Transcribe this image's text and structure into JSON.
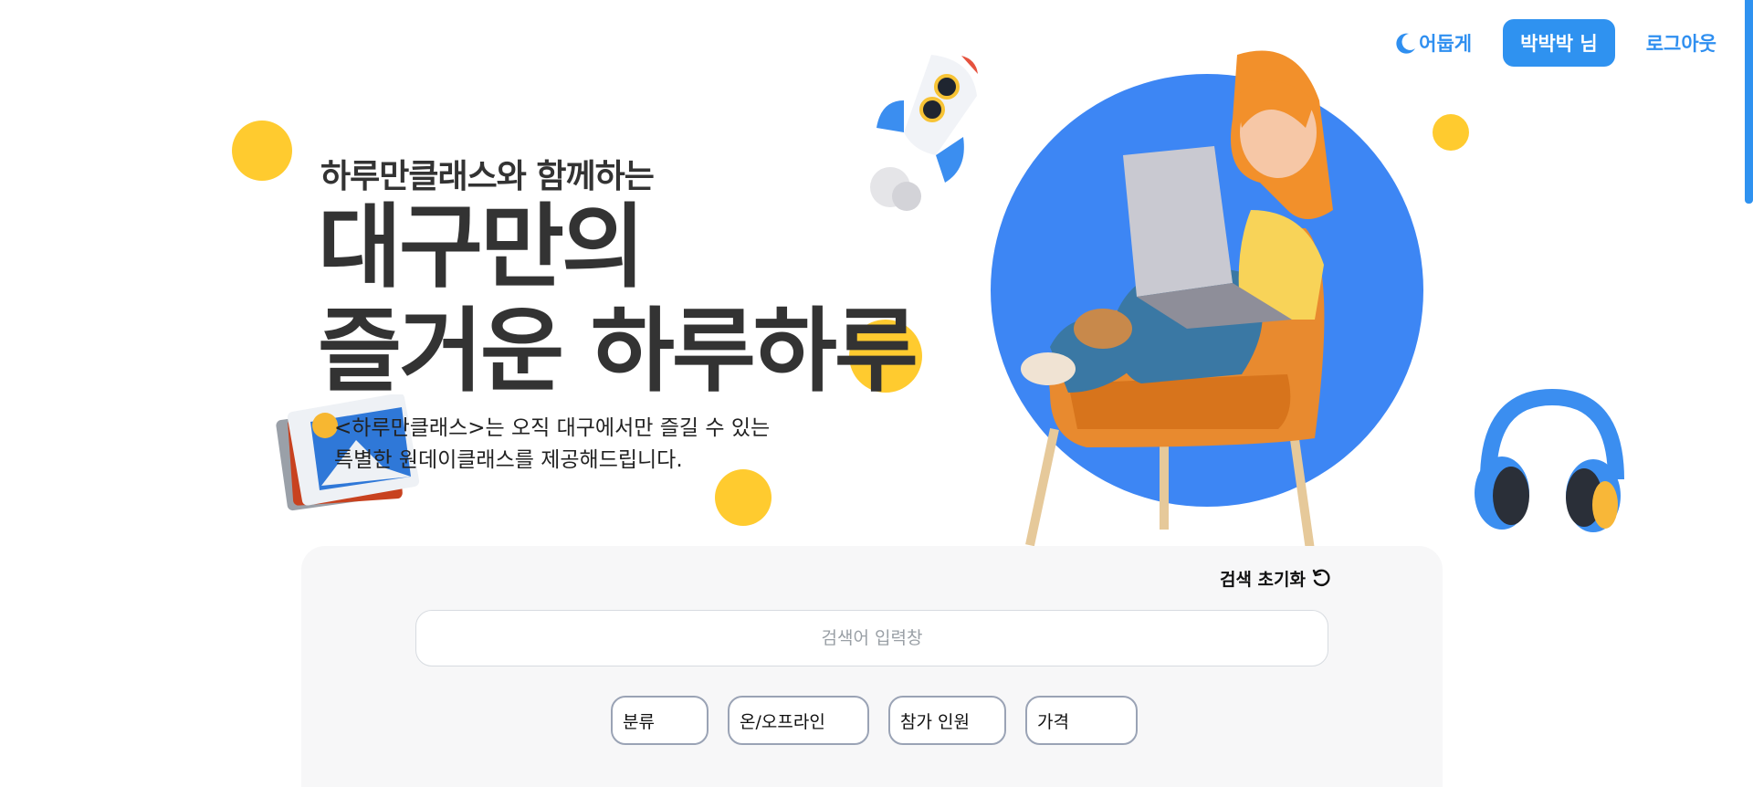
{
  "header": {
    "theme_label": "어둡게",
    "theme_icon": "moon-icon",
    "user_label": "박박박 님",
    "logout_label": "로그아웃"
  },
  "hero": {
    "subtitle": "하루만클래스와 함께하는",
    "title": "대구만의\n즐거운 하루하루",
    "description": "<하루만클래스>는 오직 대구에서만 즐길 수 있는\n특별한 원데이클래스를 제공해드립니다."
  },
  "search": {
    "reset_label": "검색 초기화",
    "reset_icon": "refresh-icon",
    "placeholder": "검색어 입력창",
    "filters": [
      "분류",
      "온/오프라인",
      "참가 인원",
      "가격"
    ]
  },
  "colors": {
    "accent": "#2f92f0",
    "yellow": "#ffcb2f",
    "blue_circle": "#3d86f4",
    "panel_bg": "#f7f7f8"
  }
}
